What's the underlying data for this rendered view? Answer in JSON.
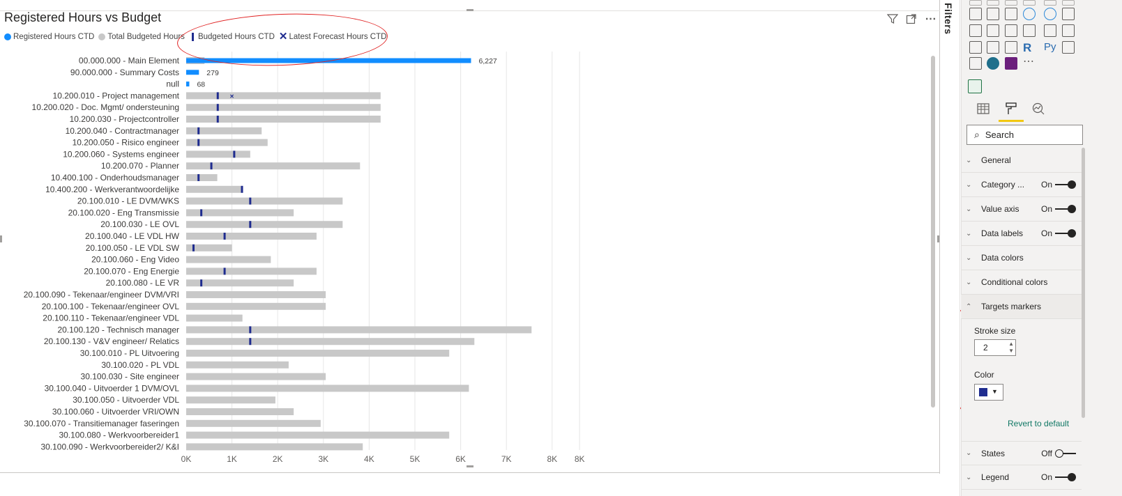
{
  "visual": {
    "title": "Registered Hours vs Budget",
    "icons": [
      "filter-icon",
      "focus-mode-icon",
      "more-options-icon"
    ],
    "legend": [
      {
        "label": "Registered Hours CTD",
        "kind": "dot",
        "color": "#118dff"
      },
      {
        "label": "Total Budgeted Hours",
        "kind": "dot",
        "color": "#c8c8c8"
      },
      {
        "label": "Budgeted Hours CTD",
        "kind": "bar",
        "color": "#1f2c8f"
      },
      {
        "label": "Latest Forecast Hours CTD",
        "kind": "x",
        "color": "#1f2c8f"
      }
    ]
  },
  "chart_data": {
    "type": "bar",
    "orientation": "horizontal",
    "categories": [
      "00.000.000 - Main Element",
      "90.000.000 - Summary Costs",
      "null",
      "10.200.010 - Project management",
      "10.200.020 - Doc. Mgmt/ ondersteuning",
      "10.200.030 - Projectcontroller",
      "10.200.040 - Contractmanager",
      "10.200.050 - Risico engineer",
      "10.200.060 - Systems engineer",
      "10.200.070 - Planner",
      "10.400.100 - Onderhoudsmanager",
      "10.400.200 - Werkverantwoordelijke",
      "20.100.010 - LE DVM/WKS",
      "20.100.020 - Eng Transmissie",
      "20.100.030 - LE OVL",
      "20.100.040 - LE VDL HW",
      "20.100.050 - LE VDL SW",
      "20.100.060 - Eng Video",
      "20.100.070 - Eng Energie",
      "20.100.080 - LE VR",
      "20.100.090 - Tekenaar/engineer DVM/VRI",
      "20.100.100 - Tekenaar/engineer OVL",
      "20.100.110 - Tekenaar/engineer VDL",
      "20.100.120 - Technisch manager",
      "20.100.130 - V&V engineer/ Relatics",
      "30.100.010 - PL Uitvoering",
      "30.100.020 - PL VDL",
      "30.100.030 - Site engineer",
      "30.100.040 - Uitvoerder 1 DVM/OVL",
      "30.100.050 - Uitvoerder VDL",
      "30.100.060 - Uitvoerder VRI/OWN",
      "30.100.070 - Transitiemanager faseringen",
      "30.100.080 - Werkvoorbereider1",
      "30.100.090 - Werkvoorbereider2/ K&I"
    ],
    "series": [
      {
        "name": "Registered Hours CTD",
        "values": [
          6227,
          279,
          68,
          null,
          null,
          null,
          null,
          null,
          null,
          null,
          null,
          null,
          null,
          null,
          null,
          null,
          null,
          null,
          null,
          null,
          null,
          null,
          null,
          null,
          null,
          null,
          null,
          null,
          null,
          null,
          null,
          null,
          null,
          null
        ]
      },
      {
        "name": "Total Budgeted Hours",
        "values": [
          400,
          null,
          null,
          4250,
          4250,
          4250,
          1650,
          1780,
          1400,
          3800,
          680,
          1200,
          3420,
          2350,
          3420,
          2850,
          1000,
          1850,
          2850,
          2350,
          3050,
          3050,
          1230,
          7550,
          6300,
          5750,
          2240,
          3050,
          6180,
          1950,
          2350,
          2940,
          5750,
          3860
        ]
      },
      {
        "name": "Budgeted Hours CTD",
        "values": [
          null,
          null,
          null,
          690,
          690,
          690,
          270,
          270,
          1050,
          550,
          270,
          1220,
          1400,
          330,
          1400,
          840,
          160,
          null,
          840,
          330,
          null,
          null,
          null,
          1400,
          1400,
          null,
          null,
          null,
          null,
          null,
          null,
          null,
          null,
          null
        ]
      },
      {
        "name": "Latest Forecast Hours CTD",
        "values": [
          null,
          null,
          null,
          1000,
          null,
          null,
          null,
          null,
          null,
          null,
          null,
          null,
          null,
          null,
          null,
          null,
          null,
          null,
          null,
          null,
          null,
          null,
          null,
          null,
          null,
          null,
          null,
          null,
          null,
          null,
          null,
          null,
          null,
          null
        ]
      }
    ],
    "data_labels": [
      "6,227",
      "279",
      "68"
    ],
    "x_ticks": [
      "0K",
      "1K",
      "2K",
      "3K",
      "4K",
      "5K",
      "6K",
      "7K",
      "8K",
      "8K"
    ],
    "x_tick_values": [
      0,
      1000,
      2000,
      3000,
      4000,
      5000,
      6000,
      7000,
      8000,
      8600
    ],
    "xlim": [
      0,
      8600
    ],
    "grid": true,
    "title": "Registered Hours vs Budget",
    "xlabel": "",
    "ylabel": ""
  },
  "filters": {
    "label": "Filters"
  },
  "pane": {
    "tabs": [
      "fields-icon",
      "format-icon",
      "analytics-icon"
    ],
    "search_placeholder": "Search",
    "sections": [
      {
        "label": "General",
        "state": "",
        "expanded": false
      },
      {
        "label": "Category ...",
        "state": "On",
        "expanded": false
      },
      {
        "label": "Value axis",
        "state": "On",
        "expanded": false
      },
      {
        "label": "Data labels",
        "state": "On",
        "expanded": false
      },
      {
        "label": "Data colors",
        "state": "",
        "expanded": false
      },
      {
        "label": "Conditional colors",
        "state": "",
        "expanded": false
      },
      {
        "label": "Targets markers",
        "state": "",
        "expanded": true
      },
      {
        "label": "States",
        "state": "Off",
        "expanded": false
      },
      {
        "label": "Legend",
        "state": "On",
        "expanded": false
      }
    ],
    "targets": {
      "stroke_label": "Stroke size",
      "stroke_value": "2",
      "color_label": "Color",
      "color_value": "#1f2c8f",
      "revert_label": "Revert to default"
    }
  }
}
